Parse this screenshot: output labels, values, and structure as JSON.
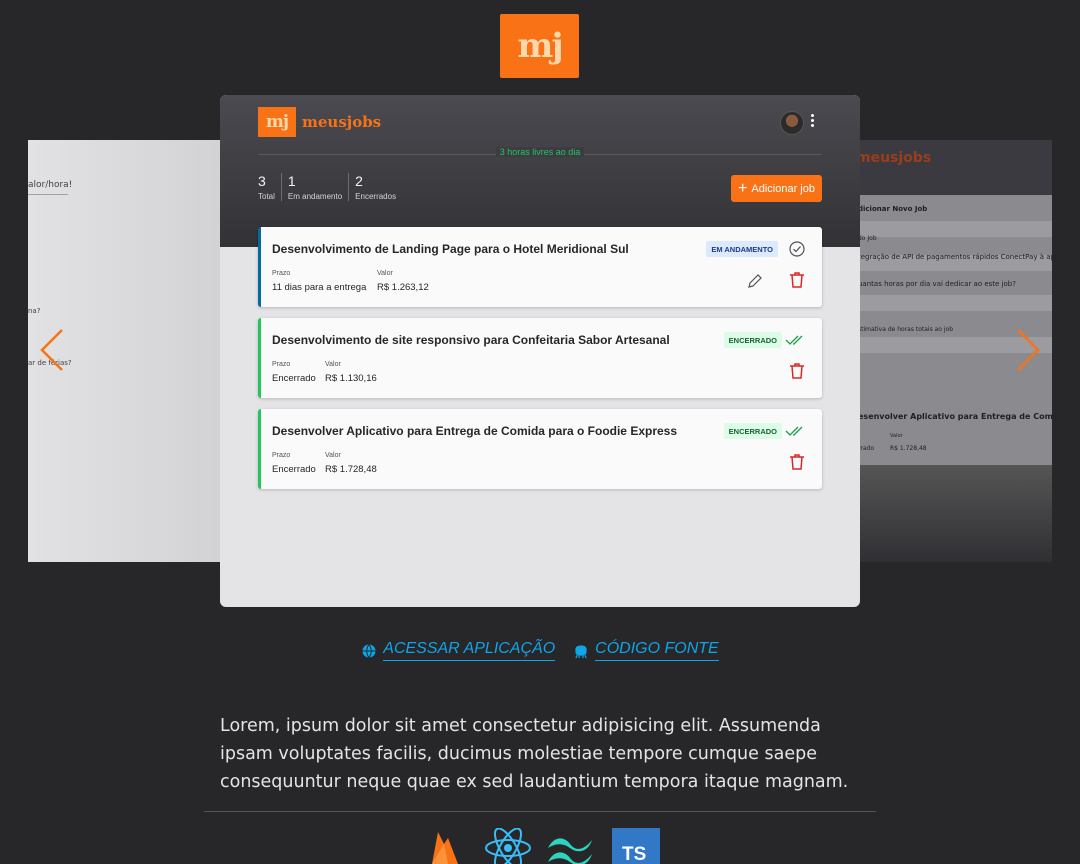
{
  "logo": {
    "text": "mj"
  },
  "app": {
    "brand_box": "mj",
    "brand_word": "meusjobs",
    "free_hours": "3 horas livres ao dia",
    "stats": [
      {
        "number": "3",
        "label": "Total"
      },
      {
        "number": "1",
        "label": "Em andamento"
      },
      {
        "number": "2",
        "label": "Encerrados"
      }
    ],
    "add_button": "Adicionar job",
    "jobs": [
      {
        "title": "Desenvolvimento de Landing Page para o Hotel Meridional Sul",
        "status": "EM ANDAMENTO",
        "prazo_label": "Prazo",
        "prazo": "11 dias para a entrega",
        "valor_label": "Valor",
        "valor": "R$ 1.263,12"
      },
      {
        "title": "Desenvolvimento de site responsivo para Confeitaria Sabor Artesanal",
        "status": "ENCERRADO",
        "prazo_label": "Prazo",
        "prazo": "Encerrado",
        "valor_label": "Valor",
        "valor": "R$ 1.130,16"
      },
      {
        "title": "Desenvolver Aplicativo para Entrega de Comida para o Foodie Express",
        "status": "ENCERRADO",
        "prazo_label": "Prazo",
        "prazo": "Encerrado",
        "valor_label": "Valor",
        "valor": "R$ 1.728,48"
      }
    ]
  },
  "side_left": {
    "t1": "alor/hora!",
    "t2": "na?",
    "t3": "ar de férias?"
  },
  "side_right": {
    "brand": "meusjobs",
    "t1": "dicionar Novo Job",
    "t2": "do Job",
    "t3": "tegração de API de pagamentos rápidos ConectPay à aplicação",
    "t4": "uantas horas por dia vai dedicar ao este job?",
    "t5": "stimativa de horas totais ao job",
    "t6": "esenvolver Aplicativo para Entrega de Comida",
    "t7": "Valor",
    "t8": "R$ 1.728,48",
    "t9": "rrado"
  },
  "links": {
    "app": "ACESSAR APLICAÇÃO",
    "source": "CÓDIGO FONTE"
  },
  "description": "Lorem, ipsum dolor sit amet consectetur adipisicing elit. Assumenda ipsam voluptates facilis, ducimus molestiae tempore cumque saepe consequuntur neque quae ex sed laudantium tempora itaque magnam.",
  "tech": {
    "ts_label": "TS"
  },
  "colors": {
    "accent": "#f97316",
    "link": "#0ea5e9",
    "success": "#22c55e",
    "progress": "#0369a1"
  }
}
